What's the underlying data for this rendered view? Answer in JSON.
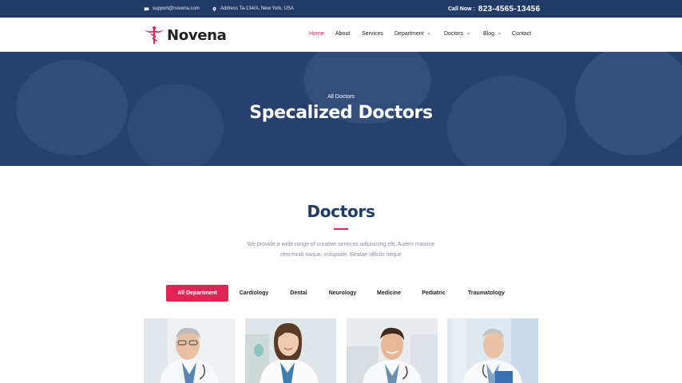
{
  "topbar": {
    "email": "support@novena.com",
    "address": "Address Ta-134/A, New York, USA",
    "call_label": "Call Now :",
    "phone": "823-4565-13456"
  },
  "brand": {
    "name": "Novena",
    "logo_icon": "caduceus-icon",
    "accent": "#e12454",
    "primary": "#223a66"
  },
  "nav": {
    "items": [
      {
        "label": "Home",
        "active": true
      },
      {
        "label": "About"
      },
      {
        "label": "Services"
      },
      {
        "label": "Department",
        "dropdown": true
      },
      {
        "label": "Doctors",
        "dropdown": true
      },
      {
        "label": "Blog",
        "dropdown": true
      },
      {
        "label": "Contact"
      }
    ]
  },
  "hero": {
    "subtitle": "All Doctors",
    "title": "Specalized Doctors"
  },
  "section": {
    "title": "Doctors",
    "description_line1": "We provide a wide range of creative services adipisicing elit. Autem maxime",
    "description_line2": "rem modi eaque, voluptate. Beatae officiis neque"
  },
  "filters": [
    "All Department",
    "Cardiology",
    "Dental",
    "Neurology",
    "Medicine",
    "Pediatric",
    "Traumatology"
  ],
  "active_filter": "All Department",
  "doctors": [
    {
      "photo": "doctor-photo-1"
    },
    {
      "photo": "doctor-photo-2"
    },
    {
      "photo": "doctor-photo-3"
    },
    {
      "photo": "doctor-photo-4"
    }
  ]
}
